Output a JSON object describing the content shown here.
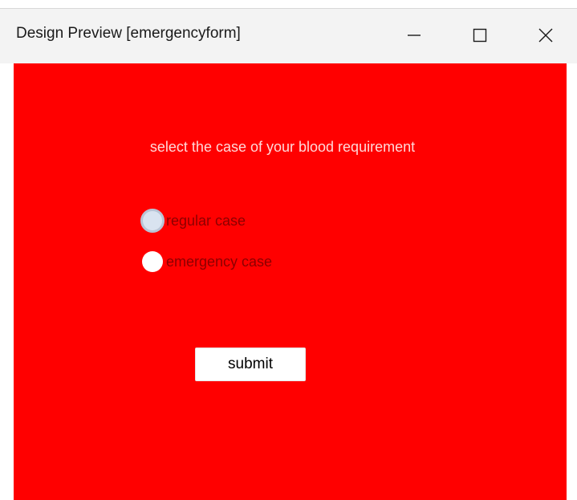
{
  "window": {
    "title": "Design Preview [emergencyform]",
    "controls": {
      "minimize_icon": "minimize-icon",
      "maximize_icon": "maximize-icon",
      "close_icon": "close-icon"
    }
  },
  "form": {
    "background_color": "#ff0000",
    "heading": "select the case of your blood requirement",
    "options": [
      {
        "label": "regular case",
        "selected": false,
        "focused": true
      },
      {
        "label": "emergency case",
        "selected": false,
        "focused": false
      }
    ],
    "submit_label": "submit"
  }
}
